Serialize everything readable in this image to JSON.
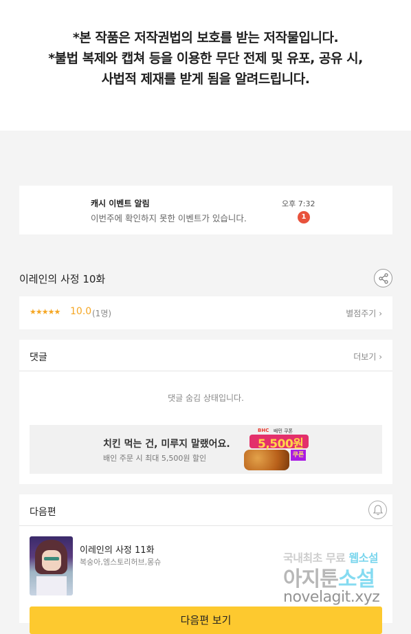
{
  "notice": {
    "line1": "*본 작품은 저작권법의 보호를 받는 저작물입니다.",
    "line2": "*불법 복제와 캡쳐 등을 이용한 무단 전제 및 유포, 공유 시,",
    "line3": "사법적 제재를 받게 됨을 알려드립니다."
  },
  "alarm": {
    "title": "캐시 이벤트 알림",
    "message": "이번주에 확인하지 못한 이벤트가 있습니다.",
    "time": "오후 7:32",
    "badge": "1"
  },
  "episode": {
    "title": "이레인의 사정 10화",
    "share_icon": "share-icon"
  },
  "rating": {
    "stars": "★★★★★",
    "score": "10.0",
    "count": "(1명)",
    "rate_label": "별점주기"
  },
  "comments": {
    "title": "댓글",
    "more_label": "더보기",
    "hidden_message": "댓글 숨김 상태입니다."
  },
  "ad": {
    "headline": "치킨 먹는 건, 미루지 말랬어요.",
    "sub": "배인 주문 시 최대 5,500원 할인",
    "brand_top": "BHC",
    "brand_sub": "배민 쿠폰",
    "price": "5,500원",
    "coupon": "쿠폰"
  },
  "next": {
    "title": "다음편",
    "episode_name": "이레인의 사정 11화",
    "authors": "복숭아,엠스토리허브,몽슈",
    "button_label": "다음편 보기"
  },
  "watermark": {
    "line1_a": "국내최초 무료 ",
    "line1_b": "웹소설",
    "line2_a": "아지툰",
    "line2_b": "소설",
    "line3": "novelagit.xyz"
  },
  "colors": {
    "accent_yellow": "#fdc92f",
    "star_orange": "#f5a623",
    "badge_red": "#e8523c"
  }
}
